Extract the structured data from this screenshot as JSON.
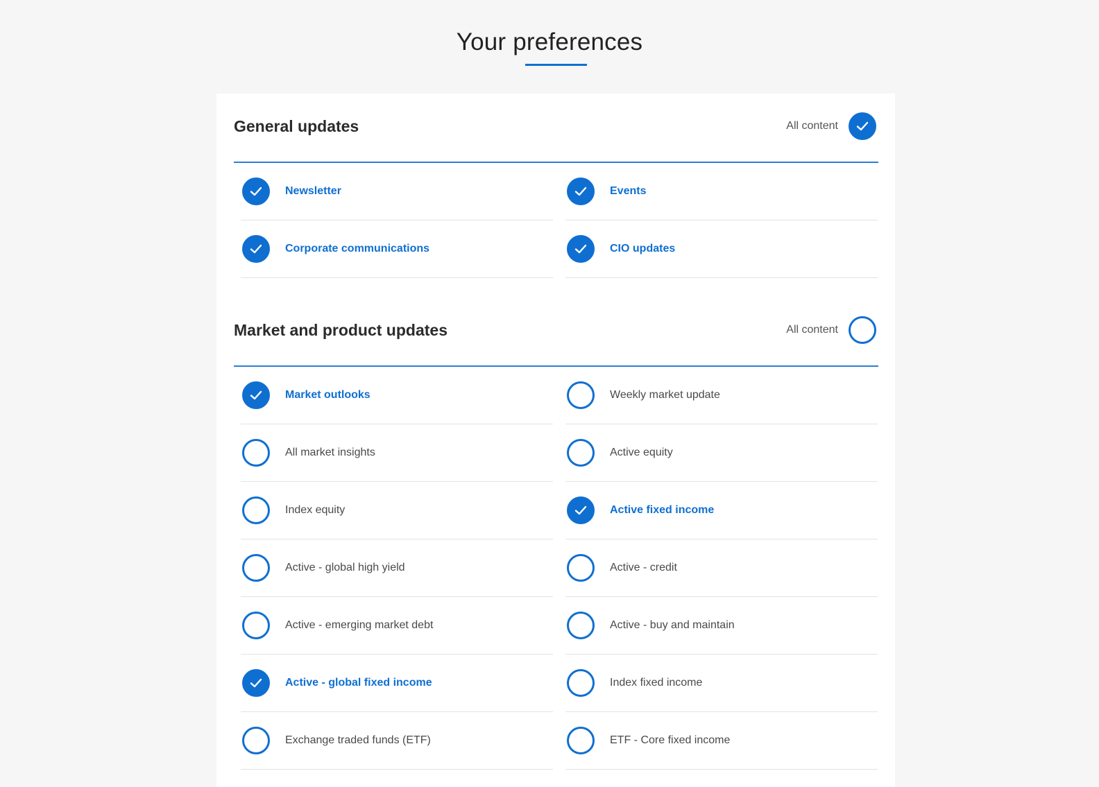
{
  "page": {
    "title": "Your preferences"
  },
  "colors": {
    "accent": "#0f6fd1",
    "background": "#f6f6f6",
    "card": "#ffffff"
  },
  "general": {
    "title": "General updates",
    "all_content_label": "All content",
    "all_content_checked": true,
    "items": [
      {
        "label": "Newsletter",
        "checked": true
      },
      {
        "label": "Events",
        "checked": true
      },
      {
        "label": "Corporate communications",
        "checked": true
      },
      {
        "label": "CIO updates",
        "checked": true
      }
    ]
  },
  "market": {
    "title": "Market and product updates",
    "all_content_label": "All content",
    "all_content_checked": false,
    "items": [
      {
        "label": "Market outlooks",
        "checked": true
      },
      {
        "label": "Weekly market update",
        "checked": false
      },
      {
        "label": "All market insights",
        "checked": false
      },
      {
        "label": "Active equity",
        "checked": false
      },
      {
        "label": "Index equity",
        "checked": false
      },
      {
        "label": "Active fixed income",
        "checked": true
      },
      {
        "label": "Active - global high yield",
        "checked": false
      },
      {
        "label": "Active - credit",
        "checked": false
      },
      {
        "label": "Active - emerging market debt",
        "checked": false
      },
      {
        "label": "Active - buy and maintain",
        "checked": false
      },
      {
        "label": "Active - global fixed income",
        "checked": true
      },
      {
        "label": "Index fixed income",
        "checked": false
      },
      {
        "label": "Exchange traded funds (ETF)",
        "checked": false
      },
      {
        "label": "ETF - Core fixed income",
        "checked": false
      }
    ]
  }
}
